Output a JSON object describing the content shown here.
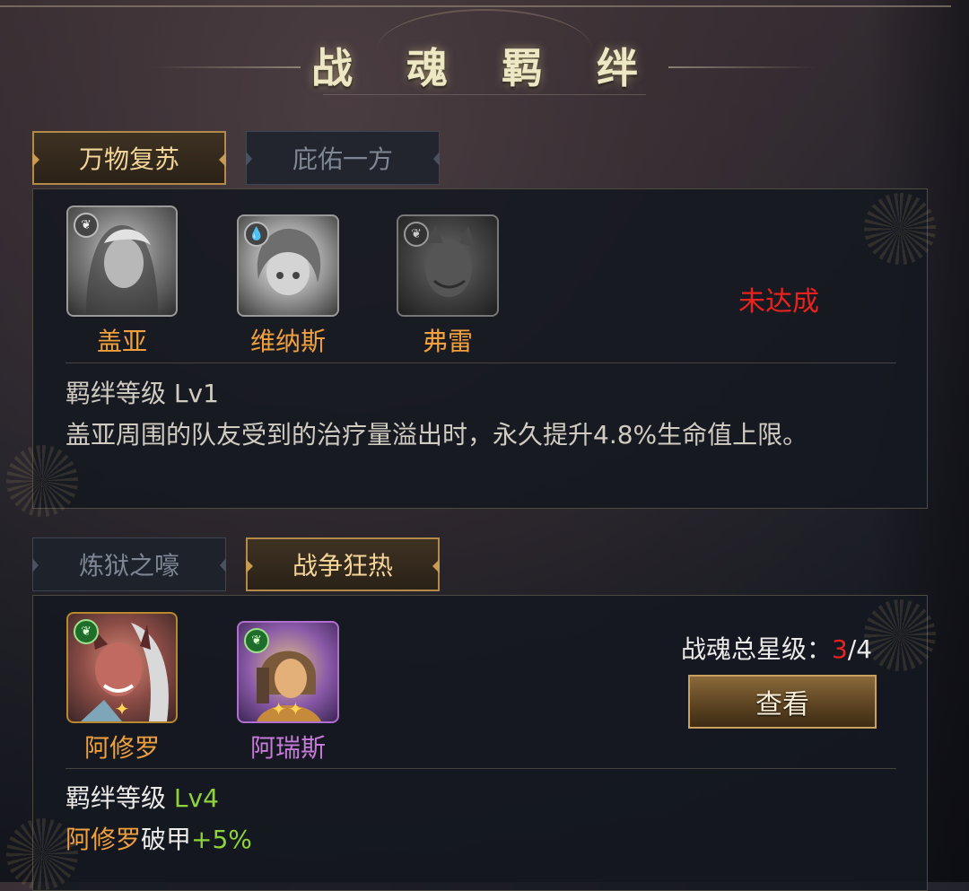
{
  "page": {
    "title": "战 魂 羁 绊"
  },
  "bond1": {
    "tabs": [
      {
        "label": "万物复苏",
        "active": true
      },
      {
        "label": "庇佑一方",
        "active": false
      }
    ],
    "heroes": [
      {
        "name": "盖亚",
        "icon": "leaf-icon",
        "owned": false
      },
      {
        "name": "维纳斯",
        "icon": "water-drop-icon",
        "owned": false
      },
      {
        "name": "弗雷",
        "icon": "leaf-icon",
        "owned": false
      }
    ],
    "status": "未达成",
    "level_label": "羁绊等级",
    "level_value": "Lv1",
    "description": "盖亚周围的队友受到的治疗量溢出时，永久提升4.8%生命值上限。"
  },
  "bond2": {
    "tabs": [
      {
        "label": "炼狱之嚎",
        "active": false
      },
      {
        "label": "战争狂热",
        "active": true
      }
    ],
    "heroes": [
      {
        "name": "阿修罗",
        "icon": "leaf-icon",
        "stars": 1,
        "name_color": "#f0a03c"
      },
      {
        "name": "阿瑞斯",
        "icon": "leaf-icon",
        "stars": 2,
        "name_color": "#c57bd8"
      }
    ],
    "star_label": "战魂总星级：",
    "star_current": "3",
    "star_separator": "/",
    "star_total": "4",
    "view_button": "查看",
    "level_label": "羁绊等级",
    "level_value": "Lv4",
    "effect_hero": "阿修罗",
    "effect_stat": "破甲",
    "effect_value": "+5%"
  },
  "colors": {
    "gold": "#f0a03c",
    "green": "#8fd33a",
    "red": "#e8231f",
    "purple": "#c57bd8"
  }
}
